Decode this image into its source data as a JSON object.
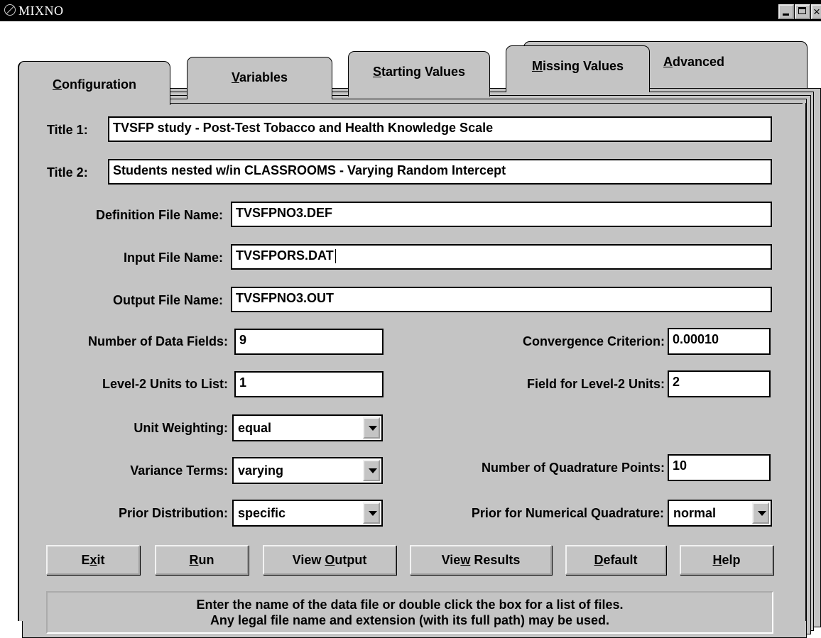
{
  "window": {
    "title": "MIXNO"
  },
  "tabs": [
    {
      "pre": "",
      "mn": "C",
      "post": "onfiguration"
    },
    {
      "pre": "",
      "mn": "V",
      "post": "ariables"
    },
    {
      "pre": "",
      "mn": "S",
      "post": "tarting Values"
    },
    {
      "pre": "",
      "mn": "M",
      "post": "issing Values"
    },
    {
      "pre": "",
      "mn": "A",
      "post": "dvanced"
    }
  ],
  "form": {
    "title1": {
      "label": "Title 1:",
      "value": "TVSFP study - Post-Test Tobacco and Health Knowledge Scale"
    },
    "title2": {
      "label": "Title 2:",
      "value": "Students nested w/in CLASSROOMS - Varying Random Intercept"
    },
    "definition_file": {
      "label": "Definition File Name:",
      "value": "TVSFPNO3.DEF"
    },
    "input_file": {
      "label": "Input File Name:",
      "value": "TVSFPORS.DAT"
    },
    "output_file": {
      "label": "Output File Name:",
      "value": "TVSFPNO3.OUT"
    },
    "num_data_fields": {
      "label": "Number of Data Fields:",
      "value": "9"
    },
    "convergence": {
      "label": "Convergence Criterion:",
      "value": "0.00010"
    },
    "level2_list": {
      "label": "Level-2 Units to List:",
      "value": "1"
    },
    "level2_field": {
      "label": "Field for Level-2 Units:",
      "value": "2"
    },
    "unit_weighting": {
      "label": "Unit Weighting:",
      "value": "equal"
    },
    "variance_terms": {
      "label": "Variance Terms:",
      "value": "varying"
    },
    "quad_points": {
      "label": "Number of Quadrature Points:",
      "value": "10"
    },
    "prior_distribution": {
      "label": "Prior Distribution:",
      "value": "specific"
    },
    "prior_quadrature": {
      "label": "Prior for Numerical Quadrature:",
      "value": "normal"
    }
  },
  "buttons": {
    "exit": {
      "pre": "E",
      "mn": "x",
      "post": "it"
    },
    "run": {
      "pre": "",
      "mn": "R",
      "post": "un"
    },
    "view_output": {
      "pre": "View ",
      "mn": "O",
      "post": "utput"
    },
    "view_results": {
      "pre": "Vie",
      "mn": "w",
      "post": " Results"
    },
    "default": {
      "pre": "",
      "mn": "D",
      "post": "efault"
    },
    "help": {
      "pre": "",
      "mn": "H",
      "post": "elp"
    }
  },
  "status": {
    "line1": "Enter the name of the data file or double click the box for a list of files.",
    "line2": "Any legal file name and extension (with its full path) may be used."
  },
  "icons": {
    "app": "no-entry-icon",
    "minimize": "minimize-icon",
    "maximize": "maximize-icon",
    "close": "close-icon",
    "dropdown": "chevron-down-icon"
  }
}
